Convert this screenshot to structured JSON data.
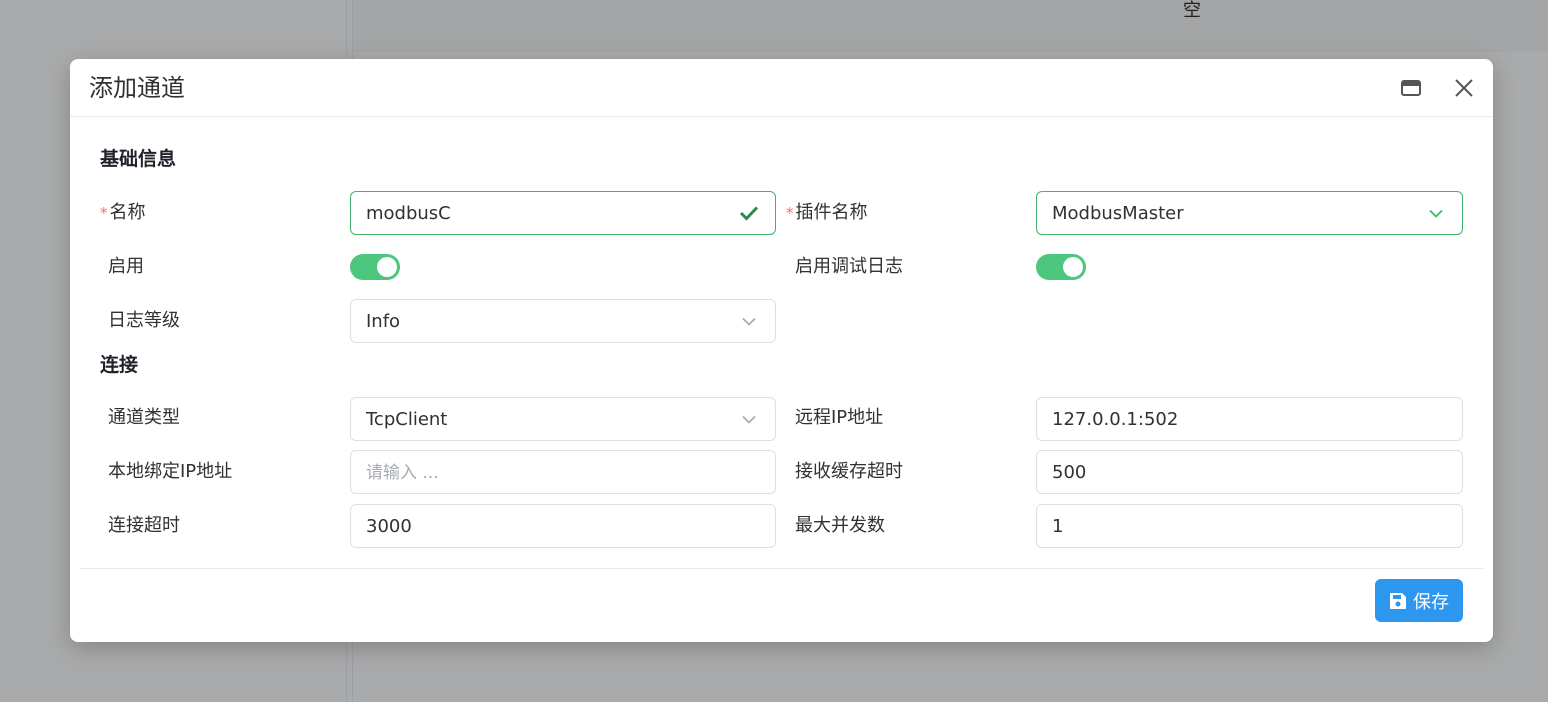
{
  "background": {
    "empty_text": "空"
  },
  "dialog": {
    "title": "添加通道",
    "sections": {
      "basic": "基础信息",
      "connection": "连接"
    },
    "basic": {
      "name_label": "名称",
      "name_value": "modbusC",
      "plugin_label": "插件名称",
      "plugin_value": "ModbusMaster",
      "enable_label": "启用",
      "enable_on": true,
      "debug_log_label": "启用调试日志",
      "debug_log_on": true,
      "log_level_label": "日志等级",
      "log_level_value": "Info"
    },
    "connection": {
      "channel_type_label": "通道类型",
      "channel_type_value": "TcpClient",
      "remote_ip_label": "远程IP地址",
      "remote_ip_value": "127.0.0.1:502",
      "local_ip_label": "本地绑定IP地址",
      "local_ip_placeholder": "请输入 ...",
      "recv_timeout_label": "接收缓存超时",
      "recv_timeout_value": "500",
      "connect_timeout_label": "连接超时",
      "connect_timeout_value": "3000",
      "max_concurrency_label": "最大并发数",
      "max_concurrency_value": "1"
    },
    "save_label": "保存"
  },
  "colors": {
    "accent": "#2d97f0",
    "switch_on": "#4cc77d",
    "valid": "#41b36b",
    "required": "#f56c6c"
  }
}
